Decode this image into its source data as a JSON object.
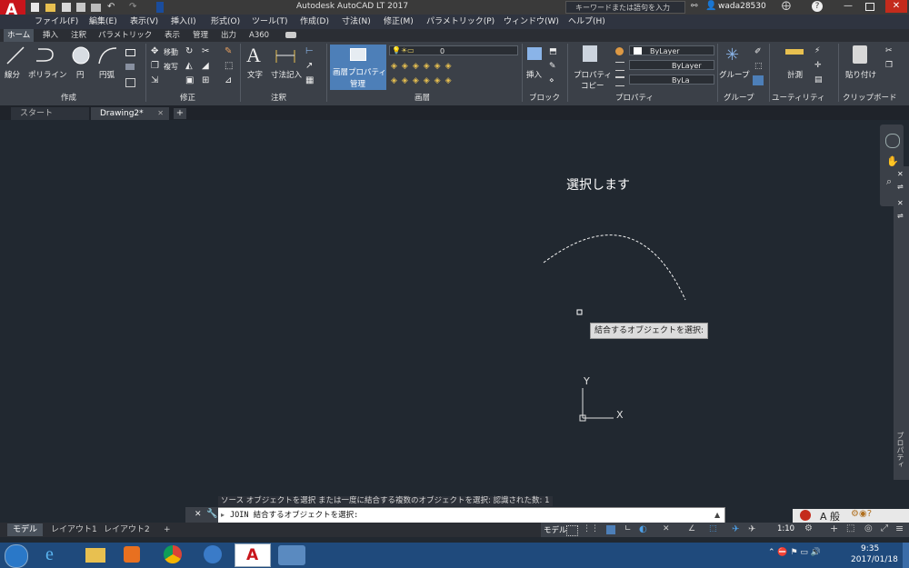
{
  "titlebar": {
    "app_title": "Autodesk AutoCAD LT 2017",
    "search_placeholder": "キーワードまたは語句を入力",
    "username": "wada28530",
    "app_badge": "LT"
  },
  "menu": [
    "ファイル(F)",
    "編集(E)",
    "表示(V)",
    "挿入(I)",
    "形式(O)",
    "ツール(T)",
    "作成(D)",
    "寸法(N)",
    "修正(M)",
    "パラメトリック(P)",
    "ウィンドウ(W)",
    "ヘルプ(H)"
  ],
  "ribbon_tabs": [
    "ホーム",
    "挿入",
    "注釈",
    "パラメトリック",
    "表示",
    "管理",
    "出力",
    "A360"
  ],
  "ribbon": {
    "draw": {
      "line": "線分",
      "polyline": "ポリライン",
      "circle": "円",
      "arc": "円弧",
      "panel": "作成"
    },
    "modify": {
      "move": "移動",
      "copy": "複写",
      "panel": "修正"
    },
    "annotation": {
      "text": "文字",
      "dimension": "寸法記入",
      "panel": "注釈"
    },
    "layers": {
      "properties": "画層プロパティ",
      "manage": "管理",
      "layer_value": "0",
      "panel": "画層"
    },
    "block": {
      "insert": "挿入",
      "panel": "ブロック"
    },
    "properties": {
      "copy": "プロパティ",
      "copy2": "コピー",
      "bylayer1": "ByLayer",
      "bylayer2": "ByLayer",
      "bylayer3": "ByLa",
      "panel": "プロパティ"
    },
    "group": {
      "group": "グループ",
      "panel": "グループ"
    },
    "utility": {
      "measure": "計測",
      "panel": "ユーティリティ"
    },
    "clipboard": {
      "paste": "貼り付け",
      "panel": "クリップボード"
    }
  },
  "doc_tabs": [
    "スタート",
    "Drawing2*"
  ],
  "canvas": {
    "message": "選択します",
    "tooltip": "結合するオブジェクトを選択:",
    "ucs_y": "Y",
    "ucs_x": "X"
  },
  "right_palette": {
    "label": "プロパティ"
  },
  "command": {
    "history": "ソース オブジェクトを選択 または一度に結合する複数のオブジェクトを選択: 認識された数: 1",
    "prompt": "JOIN 結合するオブジェクトを選択:"
  },
  "layout_tabs": [
    "モデル",
    "レイアウト1",
    "レイアウト2"
  ],
  "status": {
    "model": "モデル",
    "scale": "1:10"
  },
  "ime": {
    "label": "A 般"
  },
  "taskbar": {
    "time": "9:35",
    "date": "2017/01/18"
  },
  "colors": {
    "canvas": "#212830",
    "ribbon": "#3b4048",
    "accent": "#2a6fb8",
    "taskbar": "#1f4a7c"
  }
}
